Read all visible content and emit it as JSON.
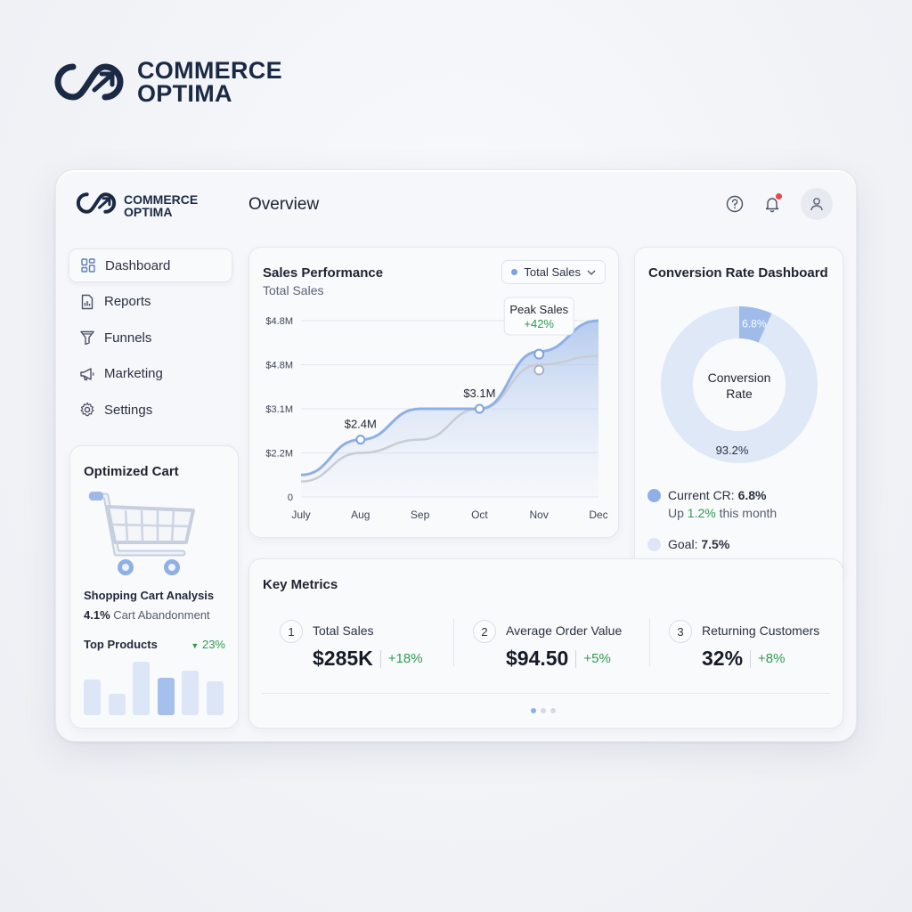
{
  "brand": {
    "line1": "COMMERCE",
    "line2": "OPTIMA"
  },
  "header": {
    "title": "Overview",
    "help_icon": "help-circle-icon",
    "bell_icon": "bell-icon",
    "avatar_icon": "user-icon"
  },
  "colors": {
    "accent": "#7ea2e0",
    "positive": "#2e9b4f",
    "notification": "#e5484d",
    "brand": "#1b2a44"
  },
  "sidebar": {
    "items": [
      {
        "label": "Dashboard",
        "icon": "grid-icon",
        "active": true
      },
      {
        "label": "Reports",
        "icon": "report-icon",
        "active": false
      },
      {
        "label": "Funnels",
        "icon": "funnel-icon",
        "active": false
      },
      {
        "label": "Marketing",
        "icon": "megaphone-icon",
        "active": false
      },
      {
        "label": "Settings",
        "icon": "gear-icon",
        "active": false
      }
    ]
  },
  "cart_card": {
    "title": "Optimized Cart",
    "analysis_title": "Shopping Cart Analysis",
    "abandon_value": "4.1%",
    "abandon_label": "Cart Abandonment",
    "top_products_label": "Top Products",
    "top_products_change": "23%",
    "bar_levels": [
      0.67,
      0.4,
      1.0,
      0.7,
      0.83,
      0.63
    ],
    "highlight_index": 3
  },
  "sales_card": {
    "title": "Sales Performance",
    "subtitle": "Total Sales",
    "select_value": "Total Sales",
    "tooltip_title": "Peak Sales",
    "tooltip_value": "+42%"
  },
  "chart_data": {
    "type": "area",
    "categories": [
      "July",
      "Aug",
      "Sep",
      "Oct",
      "Nov",
      "Dec"
    ],
    "y_tick_labels": [
      "$4.8M",
      "$4.8M",
      "$3.1M",
      "$2.2M",
      "0"
    ],
    "ylim": [
      0,
      4
    ],
    "grid": true,
    "series": [
      {
        "name": "Total Sales",
        "values": [
          0.5,
          1.3,
          2.0,
          2.0,
          3.3,
          4.0
        ]
      },
      {
        "values": [
          0.35,
          1.0,
          1.3,
          2.0,
          3.0,
          3.2
        ]
      }
    ],
    "data_labels": [
      {
        "index": 1,
        "text": "$2.4M"
      },
      {
        "index": 3,
        "text": "$3.1M"
      }
    ]
  },
  "conversion": {
    "title": "Conversion Rate Dashboard",
    "center_label_1": "Conversion",
    "center_label_2": "Rate",
    "slice_label": "6.8%",
    "rest_label": "93.2%",
    "slices": [
      6.8,
      93.2
    ],
    "current_label": "Current CR:",
    "current_value": "6.8%",
    "up_prefix": "Up",
    "up_value": "1.2%",
    "up_suffix": "this month",
    "goal_label": "Goal:",
    "goal_value": "7.5%"
  },
  "metrics": {
    "title": "Key Metrics",
    "items": [
      {
        "num": "1",
        "label": "Total Sales",
        "value": "$285K",
        "change": "+18%"
      },
      {
        "num": "2",
        "label": "Average Order Value",
        "value": "$94.50",
        "change": "+5%"
      },
      {
        "num": "3",
        "label": "Returning Customers",
        "value": "32%",
        "change": "+8%"
      }
    ],
    "pages": 3,
    "current_page": 1
  }
}
